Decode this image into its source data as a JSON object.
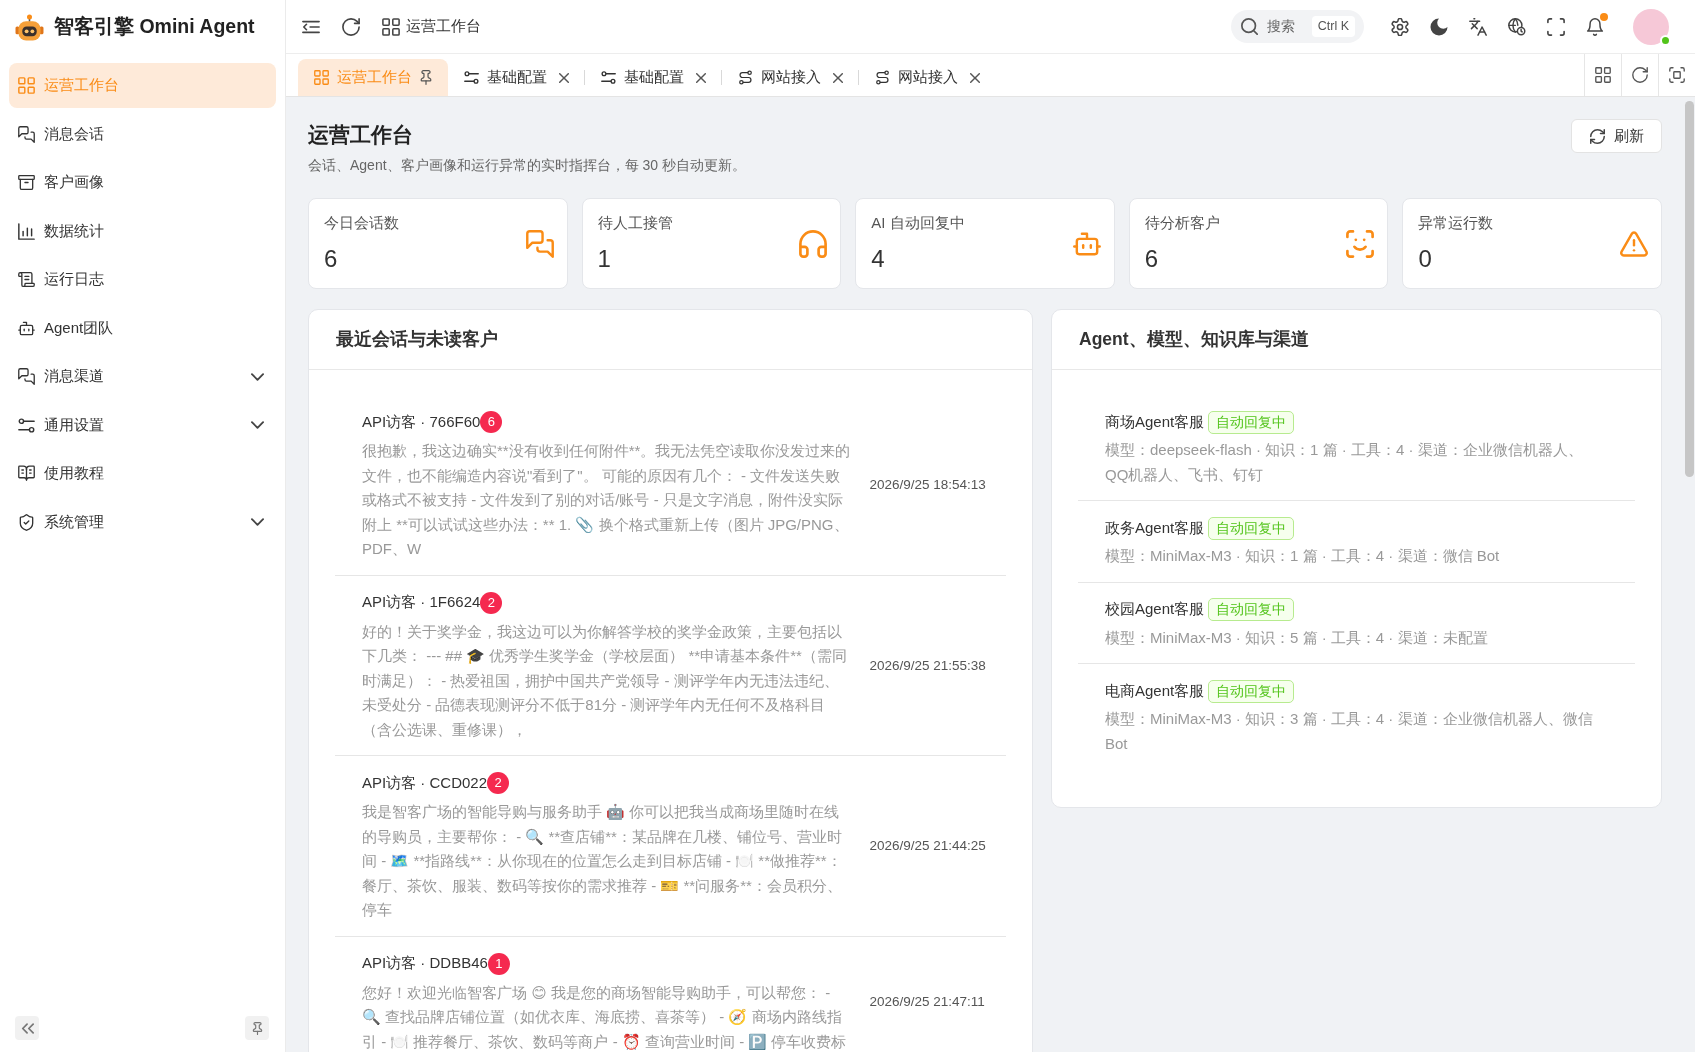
{
  "sidebar": {
    "brand": "智客引擎 Omini Agent",
    "items": [
      {
        "label": "运营工作台",
        "kind": "link",
        "selected": true
      },
      {
        "label": "消息会话",
        "kind": "link",
        "selected": false
      },
      {
        "label": "客户画像",
        "kind": "link",
        "selected": false
      },
      {
        "label": "数据统计",
        "kind": "link",
        "selected": false
      },
      {
        "label": "运行日志",
        "kind": "link",
        "selected": false
      },
      {
        "label": "Agent团队",
        "kind": "link",
        "selected": false
      },
      {
        "label": "消息渠道",
        "kind": "group",
        "selected": false,
        "expanded": false
      },
      {
        "label": "通用设置",
        "kind": "group",
        "selected": false,
        "expanded": false
      },
      {
        "label": "使用教程",
        "kind": "link",
        "selected": false
      },
      {
        "label": "系统管理",
        "kind": "group",
        "selected": false,
        "expanded": false
      }
    ]
  },
  "header": {
    "breadcrumb": "运营工作台",
    "search": {
      "label": "搜索",
      "shortcut": "Ctrl K"
    },
    "notifications": {
      "unread": true
    },
    "user": {
      "online": true
    }
  },
  "tabs": [
    {
      "label": "运营工作台",
      "selected": true,
      "pinned": true
    },
    {
      "label": "基础配置",
      "selected": false,
      "pinned": false
    },
    {
      "label": "基础配置",
      "selected": false,
      "pinned": false
    },
    {
      "label": "网站接入",
      "selected": false,
      "pinned": false
    },
    {
      "label": "网站接入",
      "selected": false,
      "pinned": false
    }
  ],
  "page": {
    "title": "运营工作台",
    "subtitle": "会话、Agent、客户画像和运行异常的实时指挥台，每 30 秒自动更新。",
    "refresh_button": "刷新"
  },
  "stats": [
    {
      "label": "今日会话数",
      "value": "6"
    },
    {
      "label": "待人工接管",
      "value": "1"
    },
    {
      "label": "AI 自动回复中",
      "value": "4"
    },
    {
      "label": "待分析客户",
      "value": "6"
    },
    {
      "label": "异常运行数",
      "value": "0"
    }
  ],
  "recent_conversations": {
    "title": "最近会话与未读客户",
    "items": [
      {
        "name": "API访客 · 766F60",
        "unread": "6",
        "message": "很抱歉，我这边确实**没有收到任何附件**。我无法凭空读取你没发过来的文件，也不能编造内容说\"看到了\"。 可能的原因有几个： - 文件发送失败或格式不被支持 - 文件发到了别的对话/账号 - 只是文字消息，附件没实际附上 **可以试试这些办法：** 1. 📎 换个格式重新上传（图片 JPG/PNG、PDF、W",
        "time": "2026/9/25 18:54:13"
      },
      {
        "name": "API访客 · 1F6624",
        "unread": "2",
        "message": "好的！关于奖学金，我这边可以为你解答学校的奖学金政策，主要包括以下几类： --- ## 🎓 优秀学生奖学金（学校层面） **申请基本条件**（需同时满足）： - 热爱祖国，拥护中国共产党领导 - 测评学年内无违法违纪、未受处分 - 品德表现测评分不低于81分 - 测评学年内无任何不及格科目（含公选课、重修课），",
        "time": "2026/9/25 21:55:38"
      },
      {
        "name": "API访客 · CCD022",
        "unread": "2",
        "message": "我是智客广场的智能导购与服务助手 🤖 你可以把我当成商场里随时在线的导购员，主要帮你： - 🔍 **查店铺**：某品牌在几楼、铺位号、营业时间 - 🗺️ **指路线**：从你现在的位置怎么走到目标店铺 - 🍽️ **做推荐**：餐厅、茶饮、服装、数码等按你的需求推荐 - 🎫 **问服务**：会员积分、停车",
        "time": "2026/9/25 21:44:25"
      },
      {
        "name": "API访客 · DDBB46",
        "unread": "1",
        "message": "您好！欢迎光临智客广场 😊 我是您的商场智能导购助手，可以帮您： - 🔍 查找品牌店铺位置（如优衣库、海底捞、喜茶等） - 🧭 商场内路线指引 - 🍽️ 推荐餐厅、茶饮、数码等商户 - ⏰ 查询营业时间 - 🅿️ 停车收费标",
        "time": "2026/9/25 21:47:11"
      }
    ]
  },
  "agents": {
    "title": "Agent、模型、知识库与渠道",
    "items": [
      {
        "name": "商场Agent客服",
        "status": "自动回复中",
        "details": "模型：deepseek-flash · 知识：1 篇 · 工具：4 · 渠道：企业微信机器人、QQ机器人、飞书、钉钉"
      },
      {
        "name": "政务Agent客服",
        "status": "自动回复中",
        "details": "模型：MiniMax-M3 · 知识：1 篇 · 工具：4 · 渠道：微信 Bot"
      },
      {
        "name": "校园Agent客服",
        "status": "自动回复中",
        "details": "模型：MiniMax-M3 · 知识：5 篇 · 工具：4 · 渠道：未配置"
      },
      {
        "name": "电商Agent客服",
        "status": "自动回复中",
        "details": "模型：MiniMax-M3 · 知识：3 篇 · 工具：4 · 渠道：企业微信机器人、微信 Bot"
      }
    ]
  }
}
